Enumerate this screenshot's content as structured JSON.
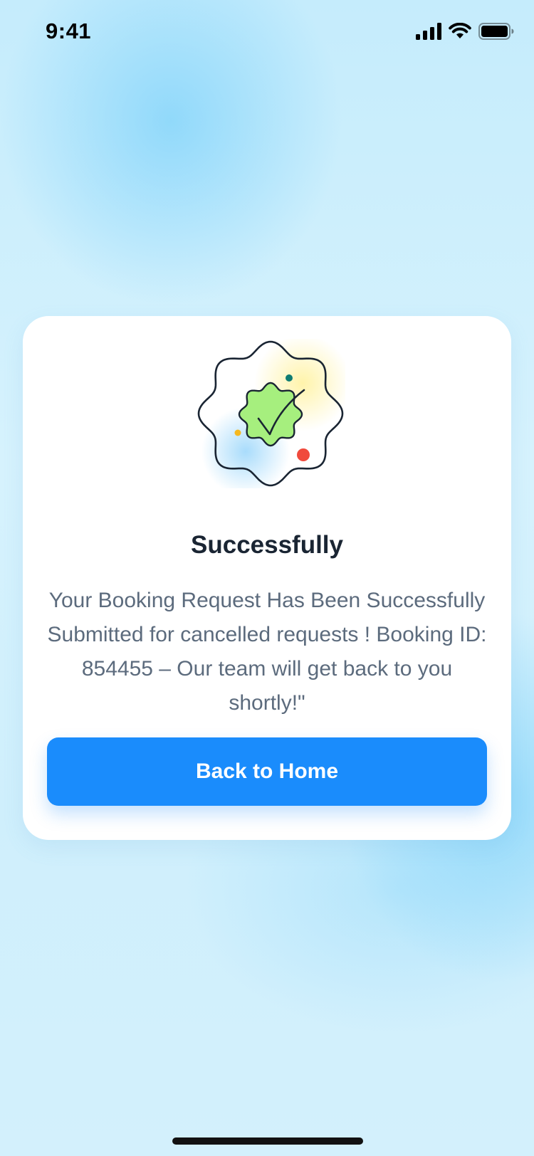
{
  "status_bar": {
    "time": "9:41",
    "icons": [
      "cellular-signal-icon",
      "wifi-icon",
      "battery-icon"
    ]
  },
  "dialog": {
    "title": "Successfully",
    "message": "Your Booking Request Has Been Successfully Submitted for cancelled requests ! Booking ID: 854455 – Our team will get back to you shortly!\"",
    "button_label": "Back to Home",
    "illustration_icon": "success-badge-check-icon"
  },
  "colors": {
    "background": "#d3f0fc",
    "card": "#ffffff",
    "accent": "#1a8cfc",
    "title_text": "#1a2533",
    "body_text": "#5c6b7d",
    "badge_green": "#a6ef7e",
    "confetti_red": "#f04a3c",
    "confetti_yellow": "#f5b820",
    "confetti_teal": "#0e7c72"
  }
}
